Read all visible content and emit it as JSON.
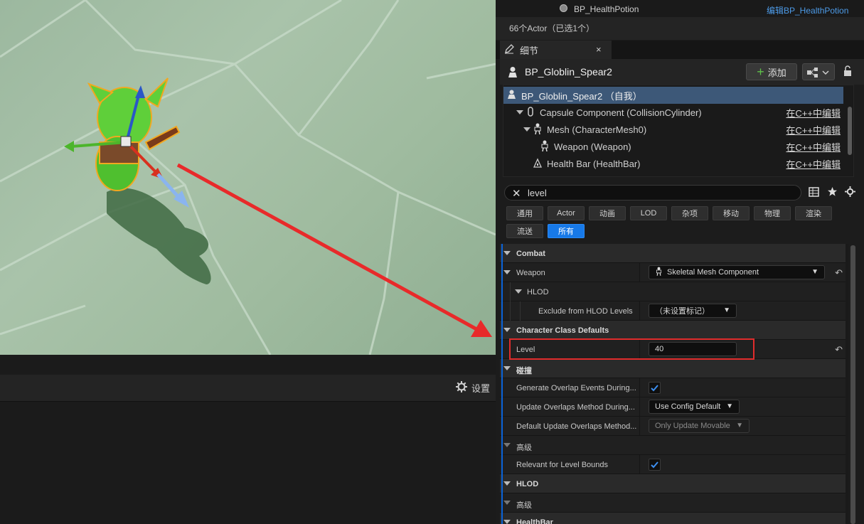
{
  "outliner": {
    "row_name": "BP_HealthPotion",
    "row_edit": "编辑BP_HealthPotion",
    "actor_count": "66个Actor（已选1个）"
  },
  "tab": {
    "label": "细节",
    "close": "×"
  },
  "details": {
    "actor_name": "BP_Globlin_Spear2",
    "add_label": "添加"
  },
  "tree": [
    {
      "label": "BP_Globlin_Spear2 （自我）",
      "cpp": ""
    },
    {
      "label": "Capsule Component (CollisionCylinder)",
      "cpp": "在C++中编辑"
    },
    {
      "label": "Mesh (CharacterMesh0)",
      "cpp": "在C++中编辑"
    },
    {
      "label": "Weapon (Weapon)",
      "cpp": "在C++中编辑"
    },
    {
      "label": "Health Bar (HealthBar)",
      "cpp": "在C++中编辑"
    }
  ],
  "search": {
    "value": "level"
  },
  "filters": [
    "通用",
    "Actor",
    "动画",
    "LOD",
    "杂项",
    "移动",
    "物理",
    "渲染",
    "流送",
    "所有"
  ],
  "props": {
    "combat": "Combat",
    "weapon_label": "Weapon",
    "weapon_value": "Skeletal Mesh Component",
    "hlod_sub": "HLOD",
    "exclude_label": "Exclude from HLOD Levels",
    "exclude_value": "（未设置标记）",
    "ccd": "Character Class Defaults",
    "level_label": "Level",
    "level_value": "40",
    "collision": "碰撞",
    "gen_overlap": "Generate Overlap Events During...",
    "update_overlap": "Update Overlaps Method During...",
    "update_overlap_value": "Use Config Default",
    "default_update": "Default Update Overlaps Method...",
    "default_update_value": "Only Update Movable",
    "advanced": "高级",
    "relevant": "Relevant for Level Bounds",
    "hlod": "HLOD",
    "advanced2": "高级",
    "healthbar": "HealthBar"
  },
  "settings_label": "设置",
  "colors": {
    "accent": "#1779e8",
    "highlight": "#e02c2c",
    "selection": "#3d5878"
  }
}
